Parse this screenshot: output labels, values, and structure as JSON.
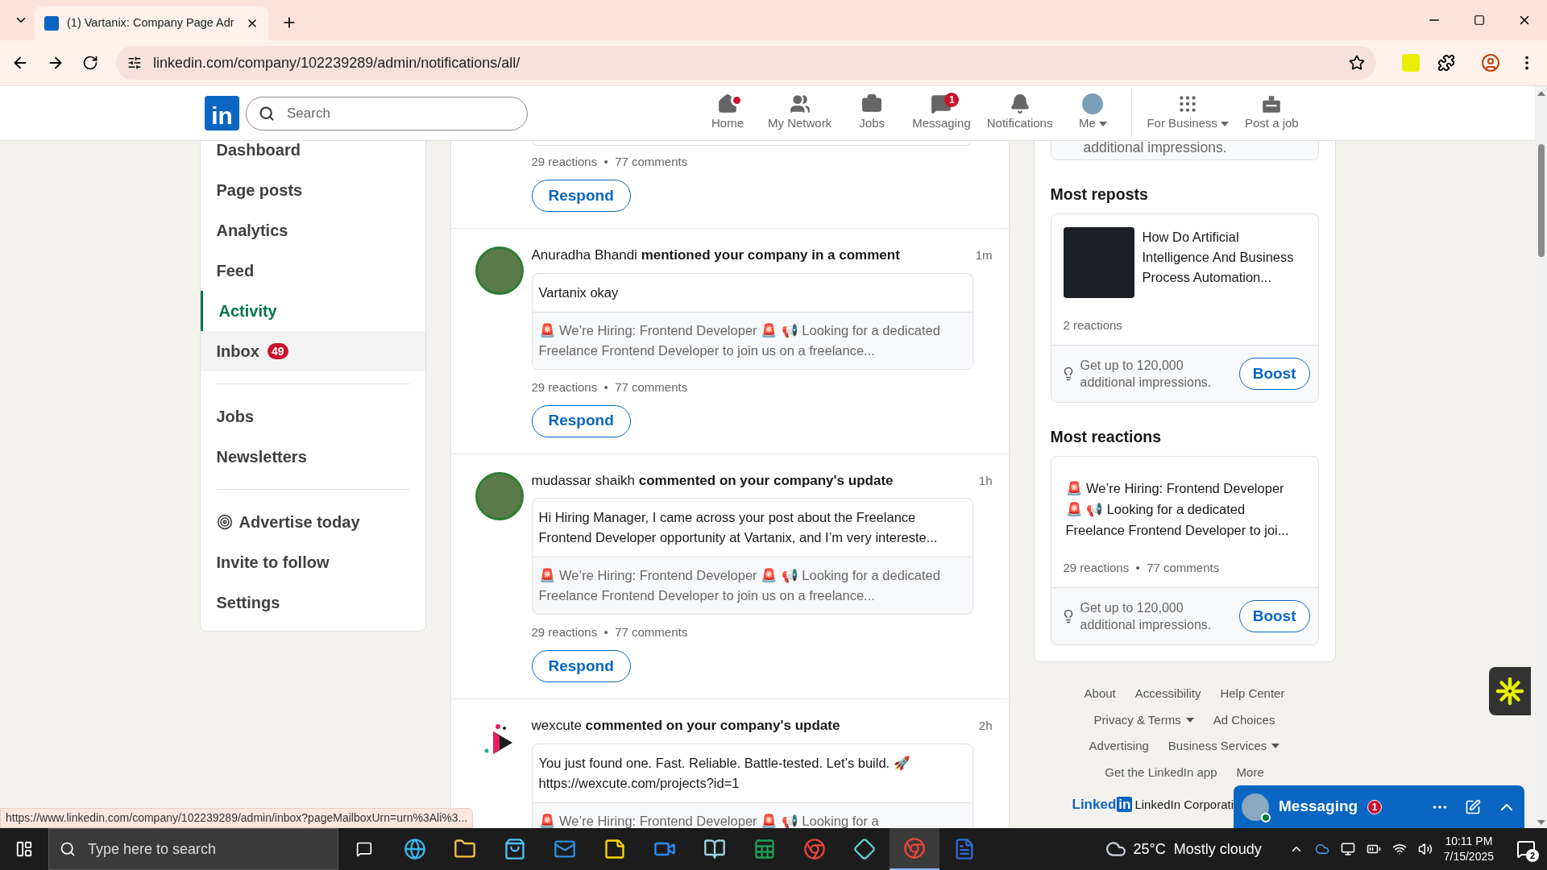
{
  "browser": {
    "tab_title": "(1) Vartanix: Company Page Adr",
    "url": "linkedin.com/company/102239289/admin/notifications/all/"
  },
  "header": {
    "logo": "in",
    "search_placeholder": "Search",
    "nav": [
      {
        "kind": "home",
        "label": "Home",
        "dot": true,
        "dropdown": false
      },
      {
        "kind": "network",
        "label": "My Network",
        "dot": false,
        "dropdown": false
      },
      {
        "kind": "jobs",
        "label": "Jobs",
        "dot": false,
        "dropdown": false
      },
      {
        "kind": "messaging",
        "label": "Messaging",
        "dot": false,
        "dropdown": false,
        "badge": "1"
      },
      {
        "kind": "notifications",
        "label": "Notifications",
        "dot": false,
        "dropdown": false
      },
      {
        "kind": "me",
        "label": "Me",
        "dot": false,
        "dropdown": true
      },
      {
        "kind": "business",
        "label": "For Business",
        "dot": false,
        "dropdown": true
      },
      {
        "kind": "post_job",
        "label": "Post a job",
        "dot": false,
        "dropdown": false
      }
    ]
  },
  "sidebar": {
    "groups": [
      {
        "items": [
          {
            "label": "Dashboard",
            "selected": false,
            "hovered": false
          },
          {
            "label": "Page posts",
            "selected": false,
            "hovered": false
          },
          {
            "label": "Analytics",
            "selected": false,
            "hovered": false
          },
          {
            "label": "Feed",
            "selected": false,
            "hovered": false
          },
          {
            "label": "Activity",
            "selected": true,
            "hovered": false
          },
          {
            "label": "Inbox",
            "selected": false,
            "hovered": true,
            "badge": "49"
          }
        ]
      },
      {
        "items": [
          {
            "label": "Jobs",
            "selected": false,
            "hovered": false
          },
          {
            "label": "Newsletters",
            "selected": false,
            "hovered": false
          }
        ]
      },
      {
        "items": [
          {
            "label": "Advertise today",
            "selected": false,
            "hovered": false,
            "icon": true
          },
          {
            "label": "Invite to follow",
            "selected": false,
            "hovered": false
          },
          {
            "label": "Settings",
            "selected": false,
            "hovered": false
          }
        ]
      }
    ]
  },
  "feed": [
    {
      "kind": "partial",
      "stats": "29 reactions  •  77 comments",
      "action": "Respond"
    },
    {
      "kind": "person",
      "name": "Anuradha Bhandi",
      "event": "mentioned your company in a comment",
      "time": "1m",
      "comment": "Vartanix okay",
      "post": "🚨 We’re Hiring: Frontend Developer 🚨   📢 Looking for a dedicated Freelance Frontend Developer to join us on a freelance...",
      "stats": "29 reactions  •  77 comments",
      "action": "Respond"
    },
    {
      "kind": "person",
      "name": "mudassar shaikh",
      "event": "commented on your company's update",
      "time": "1h",
      "comment": "Hi Hiring Manager, I came across your post about the Freelance Frontend Developer opportunity at Vartanix, and I’m very intereste...",
      "post": "🚨 We’re Hiring: Frontend Developer 🚨   📢 Looking for a dedicated Freelance Frontend Developer to join us on a freelance...",
      "stats": "29 reactions  •  77 comments",
      "action": "Respond"
    },
    {
      "kind": "company",
      "name": "wexcute",
      "event": "commented on your company's update",
      "time": "2h",
      "comment": "You just found one. Fast. Reliable. Battle-tested. Let’s build. 🚀 https://wexcute.com/projects?id=1",
      "post": "🚨 We’re Hiring: Frontend Developer 🚨   📢 Looking for a"
    }
  ],
  "right": {
    "top_boost": {
      "text": "additional impressions."
    },
    "sections": [
      {
        "title": "Most reposts",
        "kind": "thumb",
        "post": "How Do Artificial Intelligence And Business Process Automation...",
        "stats": "2 reactions",
        "boost_text": "Get up to 120,000 additional impressions.",
        "boost": "Boost"
      },
      {
        "title": "Most reactions",
        "kind": "text",
        "post": "🚨 We’re Hiring: Frontend Developer 🚨   📢 Looking for a dedicated Freelance Frontend Developer to joi...",
        "stats": "29 reactions  •  77 comments",
        "boost_text": "Get up to 120,000 additional impressions.",
        "boost": "Boost"
      }
    ],
    "footer_rows": [
      [
        {
          "label": "About",
          "dropdown": false
        },
        {
          "label": "Accessibility",
          "dropdown": false
        },
        {
          "label": "Help Center",
          "dropdown": false
        }
      ],
      [
        {
          "label": "Privacy & Terms",
          "dropdown": true
        },
        {
          "label": "Ad Choices",
          "dropdown": false
        }
      ],
      [
        {
          "label": "Advertising",
          "dropdown": false
        },
        {
          "label": "Business Services",
          "dropdown": true
        }
      ],
      [
        {
          "label": "Get the LinkedIn app",
          "dropdown": false
        },
        {
          "label": "More",
          "dropdown": false
        }
      ]
    ],
    "brand": {
      "word": "Linked",
      "box": "in",
      "corporation": "LinkedIn Corporati"
    }
  },
  "messaging": {
    "title": "Messaging",
    "badge": "1"
  },
  "status_url": "https://www.linkedin.com/company/102239289/admin/inbox?pageMailboxUrn=urn%3Ali%3...",
  "taskbar": {
    "search_placeholder": "Type here to search",
    "weather": "25°C  Mostly cloudy",
    "time": "10:11 PM",
    "date": "7/15/2025",
    "notifications": "2"
  }
}
